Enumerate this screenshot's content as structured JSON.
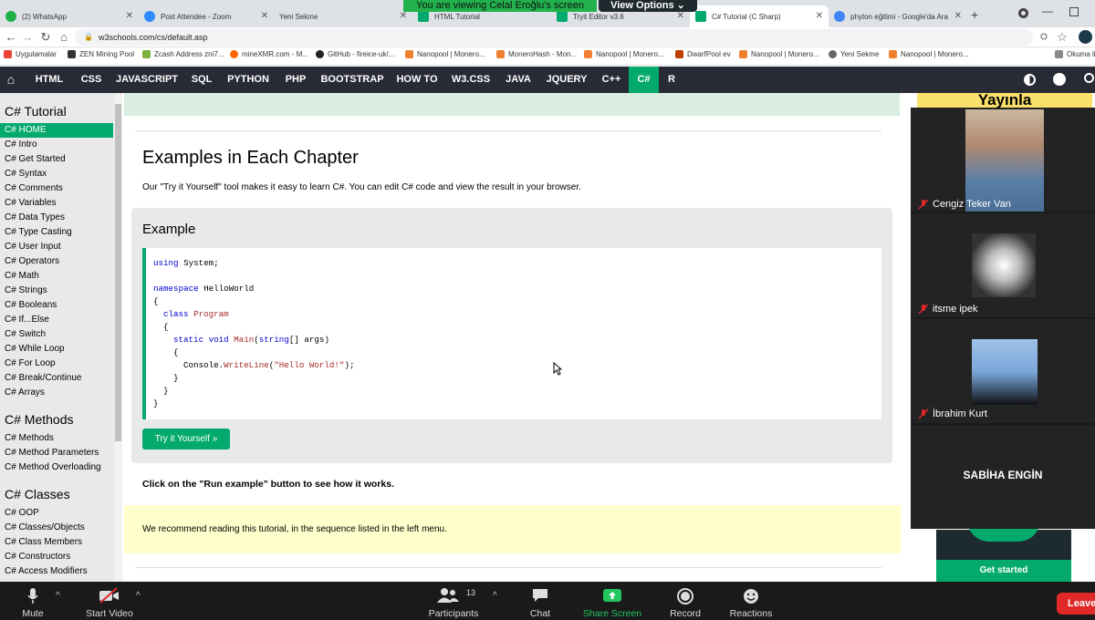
{
  "share": {
    "banner": "You are viewing Celal Eroğlu's screen",
    "view_options": "View Options"
  },
  "tabs": [
    {
      "label": "(2) WhatsApp"
    },
    {
      "label": "Post Attendee - Zoom"
    },
    {
      "label": "Yeni Sekme"
    },
    {
      "label": "HTML Tutorial"
    },
    {
      "label": "Tryit Editor v3.6"
    },
    {
      "label": "C# Tutorial (C Sharp)"
    },
    {
      "label": "phyton eğitimi - Google'da Ara"
    }
  ],
  "address": {
    "url": "w3schools.com/cs/default.asp"
  },
  "bookmarks": [
    {
      "label": "Uygulamalar"
    },
    {
      "label": "ZEN Mining Pool"
    },
    {
      "label": "Zcash Address zni7..."
    },
    {
      "label": "mineXMR.com - M..."
    },
    {
      "label": "GitHub - fireice-uk/..."
    },
    {
      "label": "Nanopool | Monero..."
    },
    {
      "label": "MoneroHash - Mon..."
    },
    {
      "label": "Nanopool | Monero..."
    },
    {
      "label": "DwarfPool ev"
    },
    {
      "label": "Nanopool | Monero..."
    },
    {
      "label": "Yeni Sekme"
    },
    {
      "label": "Nanopool | Monero..."
    },
    {
      "label": "Okuma li"
    }
  ],
  "nav": [
    "HTML",
    "CSS",
    "JAVASCRIPT",
    "SQL",
    "PYTHON",
    "PHP",
    "BOOTSTRAP",
    "HOW TO",
    "W3.CSS",
    "JAVA",
    "JQUERY",
    "C++",
    "C#",
    "R"
  ],
  "sidebar": {
    "h1": "C# Tutorial",
    "tutorial": [
      "C# HOME",
      "C# Intro",
      "C# Get Started",
      "C# Syntax",
      "C# Comments",
      "C# Variables",
      "C# Data Types",
      "C# Type Casting",
      "C# User Input",
      "C# Operators",
      "C# Math",
      "C# Strings",
      "C# Booleans",
      "C# If...Else",
      "C# Switch",
      "C# While Loop",
      "C# For Loop",
      "C# Break/Continue",
      "C# Arrays"
    ],
    "h2": "C# Methods",
    "methods": [
      "C# Methods",
      "C# Method Parameters",
      "C# Method Overloading"
    ],
    "h3": "C# Classes",
    "classes": [
      "C# OOP",
      "C# Classes/Objects",
      "C# Class Members",
      "C# Constructors",
      "C# Access Modifiers"
    ]
  },
  "main": {
    "heading": "Examples in Each Chapter",
    "desc": "Our \"Try it Yourself\" tool makes it easy to learn C#. You can edit C# code and view the result in your browser.",
    "example_title": "Example",
    "try_button": "Try it Yourself »",
    "run_note": "Click on the \"Run example\" button to see how it works.",
    "recommend": "We recommend reading this tutorial, in the sequence listed in the left menu."
  },
  "code": {
    "using_kw": "using",
    "using_rest": " System;",
    "namespace_kw": "namespace",
    "namespace_rest": " HelloWorld",
    "brace_open": "{",
    "brace_close": "}",
    "class_kw": "class",
    "class_name": "Program",
    "static_kw": "static void",
    "main_name": "Main",
    "string_kw": "string",
    "args_rest": "[] args)",
    "console": "Console.",
    "writeline": "WriteLine",
    "hello": "\"Hello World!\"",
    "end": ");"
  },
  "ad": {
    "top": "Yayınla",
    "get_started": "Get started"
  },
  "participants": [
    {
      "name": "Cengiz Teker Van"
    },
    {
      "name": "itsme ipek"
    },
    {
      "name": "İbrahim Kurt"
    },
    {
      "name": "SABİHA ENGİN"
    }
  ],
  "zoombar": {
    "mute": "Mute",
    "start_video": "Start Video",
    "participants": "Participants",
    "participant_count": "13",
    "chat": "Chat",
    "share_screen": "Share Screen",
    "record": "Record",
    "reactions": "Reactions",
    "leave": "Leave"
  },
  "colors": {
    "w3_green": "#04aa6d",
    "w3_nav": "#282a35",
    "zoom_red": "#e02828"
  }
}
